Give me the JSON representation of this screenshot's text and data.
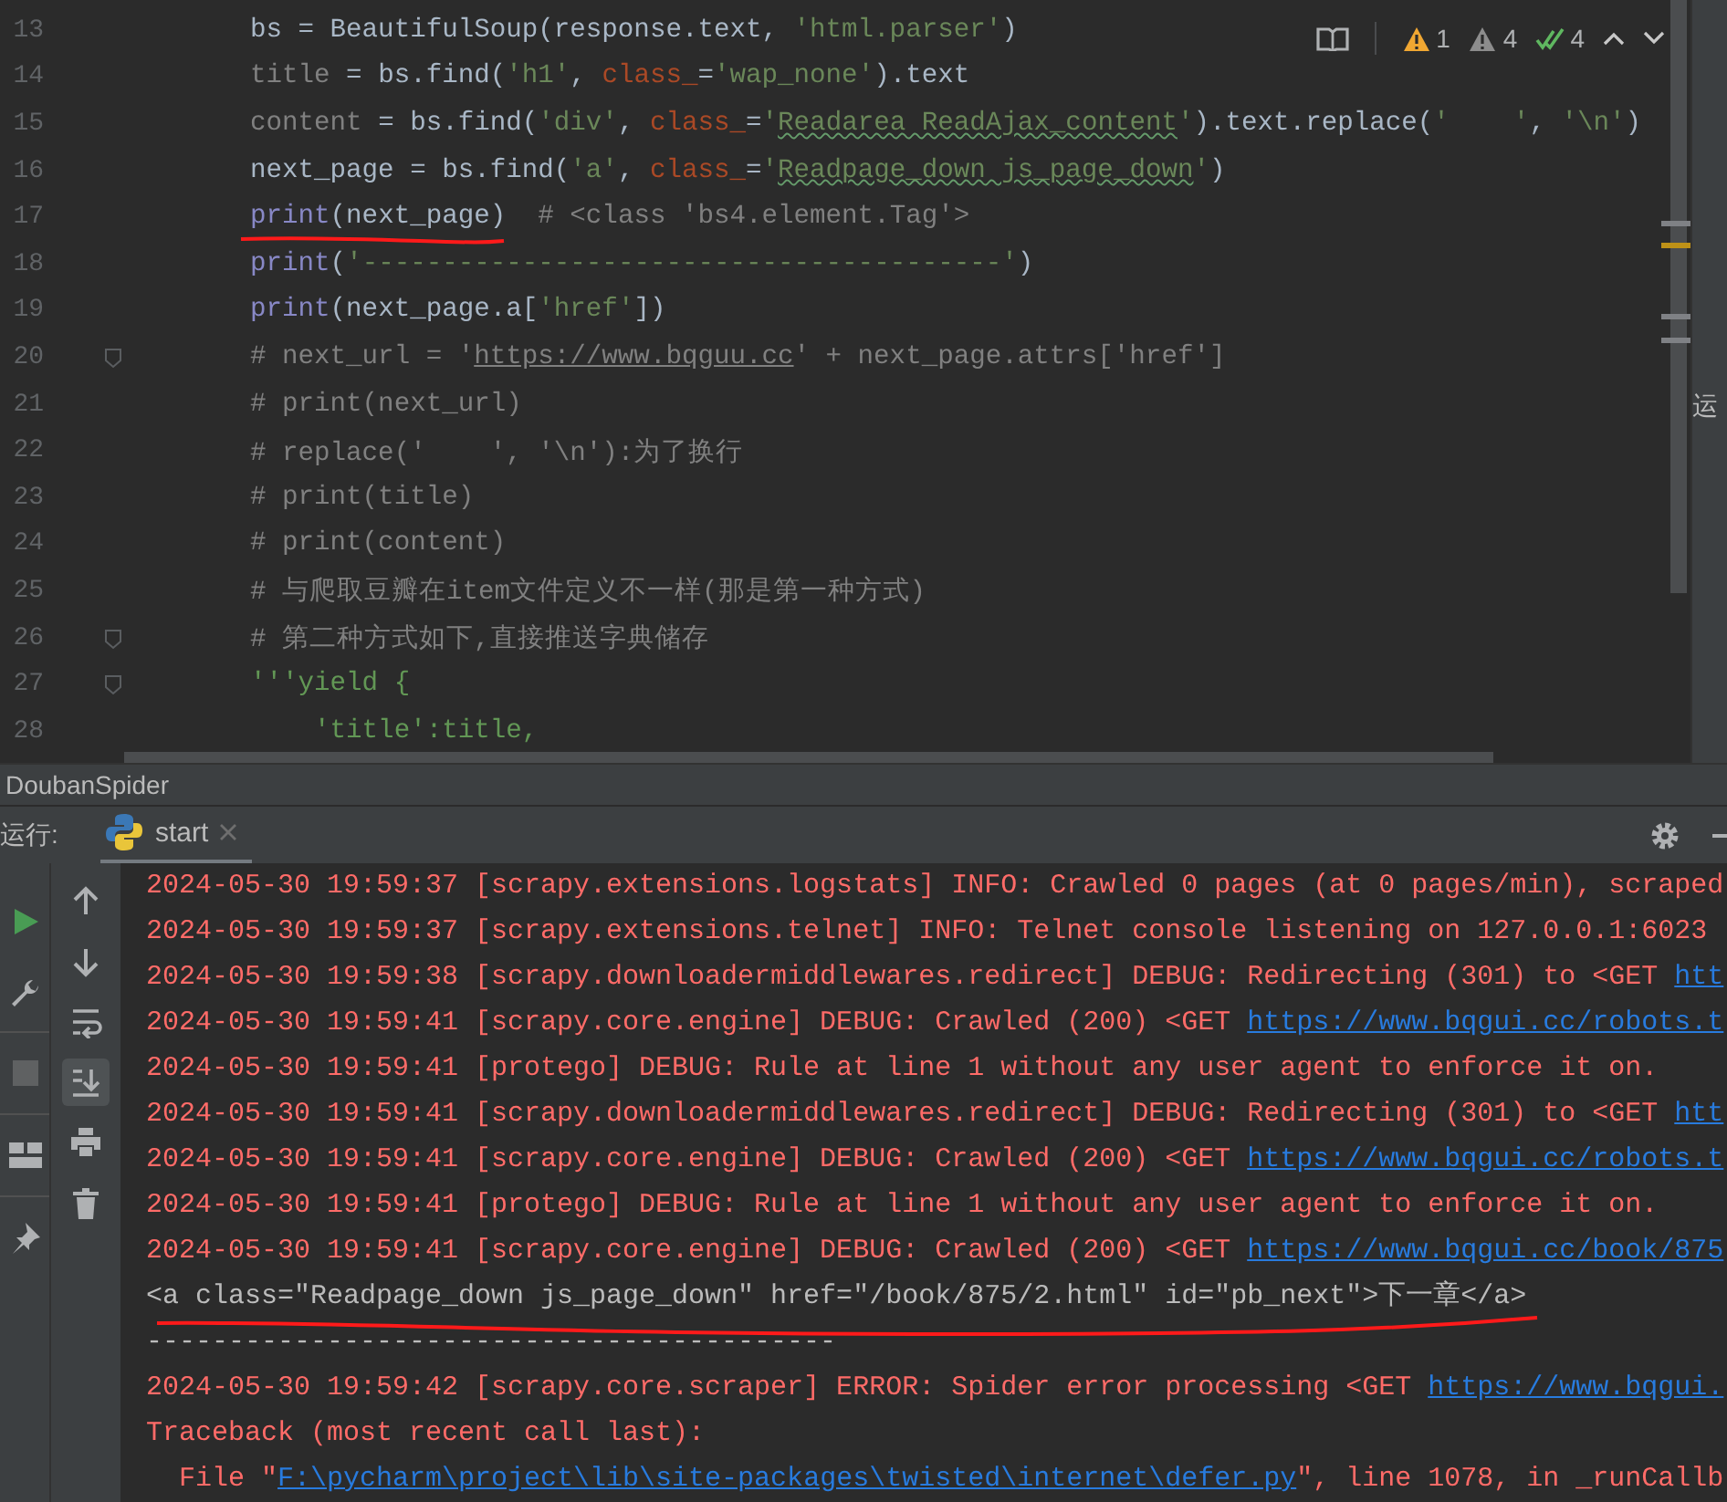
{
  "editor": {
    "lines": [
      {
        "number": "13",
        "fold_marker": false,
        "tokens": [
          {
            "kind": "plain",
            "text": "bs = BeautifulSoup(response.text, "
          },
          {
            "kind": "string",
            "text": "'html.parser'"
          },
          {
            "kind": "plain",
            "text": ")"
          }
        ]
      },
      {
        "number": "14",
        "fold_marker": false,
        "tokens": [
          {
            "kind": "dim",
            "text": "title"
          },
          {
            "kind": "plain",
            "text": " = bs.find("
          },
          {
            "kind": "string",
            "text": "'h1'"
          },
          {
            "kind": "plain",
            "text": ", "
          },
          {
            "kind": "param",
            "text": "class_"
          },
          {
            "kind": "plain",
            "text": "="
          },
          {
            "kind": "string",
            "text": "'wap_none'"
          },
          {
            "kind": "plain",
            "text": ").text"
          }
        ]
      },
      {
        "number": "15",
        "fold_marker": false,
        "tokens": [
          {
            "kind": "dim",
            "text": "content"
          },
          {
            "kind": "plain",
            "text": " = bs.find("
          },
          {
            "kind": "string",
            "text": "'div'"
          },
          {
            "kind": "plain",
            "text": ", "
          },
          {
            "kind": "param",
            "text": "class_"
          },
          {
            "kind": "plain",
            "text": "="
          },
          {
            "kind": "string",
            "text": "'"
          },
          {
            "kind": "typo",
            "text": "Readarea ReadAjax_content"
          },
          {
            "kind": "string",
            "text": "'"
          },
          {
            "kind": "plain",
            "text": ").text.replace("
          },
          {
            "kind": "string",
            "text": "'    '"
          },
          {
            "kind": "plain",
            "text": ", "
          },
          {
            "kind": "string",
            "text": "'\\n'"
          },
          {
            "kind": "plain",
            "text": ")"
          }
        ]
      },
      {
        "number": "16",
        "fold_marker": false,
        "tokens": [
          {
            "kind": "plain",
            "text": "next_page = bs.find("
          },
          {
            "kind": "string",
            "text": "'a'"
          },
          {
            "kind": "plain",
            "text": ", "
          },
          {
            "kind": "param",
            "text": "class_"
          },
          {
            "kind": "plain",
            "text": "="
          },
          {
            "kind": "string",
            "text": "'"
          },
          {
            "kind": "typo",
            "text": "Readpage_down js_page_down"
          },
          {
            "kind": "string",
            "text": "'"
          },
          {
            "kind": "plain",
            "text": ")"
          }
        ]
      },
      {
        "number": "17",
        "fold_marker": false,
        "tokens": [
          {
            "kind": "builtin",
            "text": "print"
          },
          {
            "kind": "plain",
            "text": "(next_page)  "
          },
          {
            "kind": "comment",
            "text": "# <class 'bs4.element.Tag'>"
          }
        ]
      },
      {
        "number": "18",
        "fold_marker": false,
        "tokens": [
          {
            "kind": "builtin",
            "text": "print"
          },
          {
            "kind": "plain",
            "text": "("
          },
          {
            "kind": "string",
            "text": "'----------------------------------------'"
          },
          {
            "kind": "plain",
            "text": ")"
          }
        ]
      },
      {
        "number": "19",
        "fold_marker": false,
        "tokens": [
          {
            "kind": "builtin",
            "text": "print"
          },
          {
            "kind": "plain",
            "text": "(next_page.a["
          },
          {
            "kind": "string",
            "text": "'href'"
          },
          {
            "kind": "plain",
            "text": "])"
          }
        ]
      },
      {
        "number": "20",
        "fold_marker": true,
        "tokens": [
          {
            "kind": "comment",
            "text": "# next_url = '"
          },
          {
            "kind": "comment_link",
            "text": "https://www.bqguu.cc"
          },
          {
            "kind": "comment",
            "text": "' + next_page.attrs['href']"
          }
        ]
      },
      {
        "number": "21",
        "fold_marker": false,
        "tokens": [
          {
            "kind": "comment",
            "text": "# print(next_url)"
          }
        ]
      },
      {
        "number": "22",
        "fold_marker": false,
        "tokens": [
          {
            "kind": "comment",
            "text": "# replace('    ', '\\n'):为了换行"
          }
        ]
      },
      {
        "number": "23",
        "fold_marker": false,
        "tokens": [
          {
            "kind": "comment",
            "text": "# print(title)"
          }
        ]
      },
      {
        "number": "24",
        "fold_marker": false,
        "tokens": [
          {
            "kind": "comment",
            "text": "# print(content)"
          }
        ]
      },
      {
        "number": "25",
        "fold_marker": false,
        "tokens": [
          {
            "kind": "comment",
            "text": "# 与爬取豆瓣在item文件定义不一样(那是第一种方式)"
          }
        ]
      },
      {
        "number": "26",
        "fold_marker": true,
        "tokens": [
          {
            "kind": "comment",
            "text": "# 第二种方式如下,直接推送字典储存"
          }
        ]
      },
      {
        "number": "27",
        "fold_marker": true,
        "tokens": [
          {
            "kind": "docstring",
            "text": "'''yield {"
          }
        ]
      },
      {
        "number": "28",
        "fold_marker": false,
        "tokens": [
          {
            "kind": "docstring",
            "text": "    'title':title,"
          }
        ]
      }
    ],
    "inspections": [
      {
        "kind": "warning",
        "count": "1"
      },
      {
        "kind": "weak_warning",
        "count": "4"
      },
      {
        "kind": "typo",
        "count": "4"
      }
    ]
  },
  "side_strip": {
    "label": "运"
  },
  "run_panel": {
    "project": "DoubanSpider",
    "label": "运行:",
    "tabs": [
      {
        "label": "start",
        "selected": true
      }
    ],
    "scroll_to_end": true,
    "console": [
      [
        {
          "kind": "log",
          "text": "2024-05-30 19:59:37 [scrapy.extensions.logstats] INFO: Crawled 0 pages (at 0 pages/min), scraped"
        }
      ],
      [
        {
          "kind": "log",
          "text": "2024-05-30 19:59:37 [scrapy.extensions.telnet] INFO: Telnet console listening on 127.0.0.1:6023"
        }
      ],
      [
        {
          "kind": "log",
          "text": "2024-05-30 19:59:38 [scrapy.downloadermiddlewares.redirect] DEBUG: Redirecting (301) to <GET "
        },
        {
          "kind": "link",
          "text": "htt"
        }
      ],
      [
        {
          "kind": "log",
          "text": "2024-05-30 19:59:41 [scrapy.core.engine] DEBUG: Crawled (200) <GET "
        },
        {
          "kind": "link",
          "text": "https://www.bqgui.cc/robots.t"
        }
      ],
      [
        {
          "kind": "log",
          "text": "2024-05-30 19:59:41 [protego] DEBUG: Rule at line 1 without any user agent to enforce it on."
        }
      ],
      [
        {
          "kind": "log",
          "text": "2024-05-30 19:59:41 [scrapy.downloadermiddlewares.redirect] DEBUG: Redirecting (301) to <GET "
        },
        {
          "kind": "link",
          "text": "htt"
        }
      ],
      [
        {
          "kind": "log",
          "text": "2024-05-30 19:59:41 [scrapy.core.engine] DEBUG: Crawled (200) <GET "
        },
        {
          "kind": "link",
          "text": "https://www.bqgui.cc/robots.t"
        }
      ],
      [
        {
          "kind": "log",
          "text": "2024-05-30 19:59:41 [protego] DEBUG: Rule at line 1 without any user agent to enforce it on."
        }
      ],
      [
        {
          "kind": "log",
          "text": "2024-05-30 19:59:41 [scrapy.core.engine] DEBUG: Crawled (200) <GET "
        },
        {
          "kind": "link",
          "text": "https://www.bqgui.cc/book/875"
        }
      ],
      [
        {
          "kind": "output",
          "text": "<a class=\"Readpage_down js_page_down\" href=\"/book/875/2.html\" id=\"pb_next\">下一章</a>"
        }
      ],
      [
        {
          "kind": "output",
          "text": "------------------------------------------"
        }
      ],
      [
        {
          "kind": "log",
          "text": "2024-05-30 19:59:42 [scrapy.core.scraper] ERROR: Spider error processing <GET "
        },
        {
          "kind": "link",
          "text": "https://www.bqgui."
        }
      ],
      [
        {
          "kind": "log",
          "text": "Traceback (most recent call last):"
        }
      ],
      [
        {
          "kind": "log",
          "text": "  File \""
        },
        {
          "kind": "link",
          "text": "F:\\pycharm\\project\\lib\\site-packages\\twisted\\internet\\defer.py"
        },
        {
          "kind": "log",
          "text": "\", line 1078, in _runCallb"
        }
      ]
    ]
  }
}
